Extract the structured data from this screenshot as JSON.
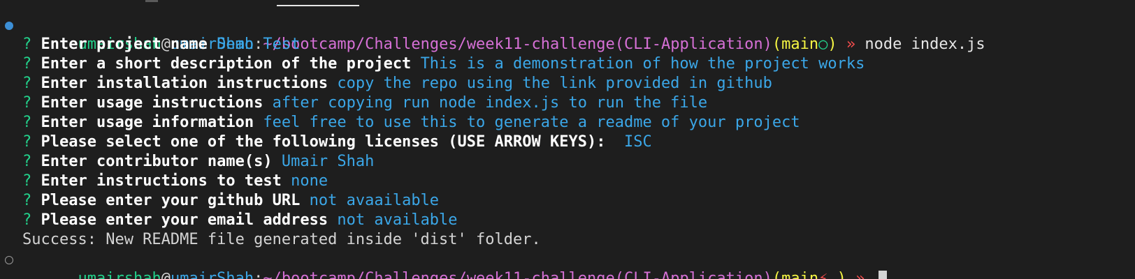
{
  "colors": {
    "background": "#1e1e1e",
    "user": "#23d18b",
    "host": "#3ba7e8",
    "path": "#d670d6",
    "branch": "#f5f543",
    "answer": "#3ba7e8",
    "prompt_marker": "#23d18b",
    "arrow": "#f14c4c"
  },
  "shell_prompt": {
    "user": "umairshah",
    "at": "@",
    "host": "umairShah",
    "colon": ":",
    "path": "~/bootcamp/Challenges/week11-challenge(CLI-Application)",
    "branch_open": "(",
    "branch": "main",
    "branch_close": ")",
    "arrow": " » "
  },
  "first_command": {
    "status_glyph": "○",
    "command": "node index.js"
  },
  "prompts": [
    {
      "marker": "?",
      "question": "Enter project name",
      "answer": "Demo Test"
    },
    {
      "marker": "?",
      "question": "Enter a short description of the project",
      "answer": "This is a demonstration of how the project works"
    },
    {
      "marker": "?",
      "question": "Enter installation instructions",
      "answer": "copy the repo using the link provided in github"
    },
    {
      "marker": "?",
      "question": "Enter usage instructions",
      "answer": "after copying run node index.js to run the file"
    },
    {
      "marker": "?",
      "question": "Enter usage information",
      "answer": "feel free to use this to generate a readme of your project"
    },
    {
      "marker": "?",
      "question": "Please select one of the following licenses (USE ARROW KEYS):",
      "answer": " ISC"
    },
    {
      "marker": "?",
      "question": "Enter contributor name(s)",
      "answer": "Umair Shah"
    },
    {
      "marker": "?",
      "question": "Enter instructions to test",
      "answer": "none"
    },
    {
      "marker": "?",
      "question": "Please enter your github URL",
      "answer": "not avaailable"
    },
    {
      "marker": "?",
      "question": "Please enter your email address",
      "answer": "not available"
    }
  ],
  "success_message": "Success: New README file generated inside 'dist' folder.",
  "second_prompt": {
    "status_glyph": "⚡",
    "trailing": " "
  }
}
